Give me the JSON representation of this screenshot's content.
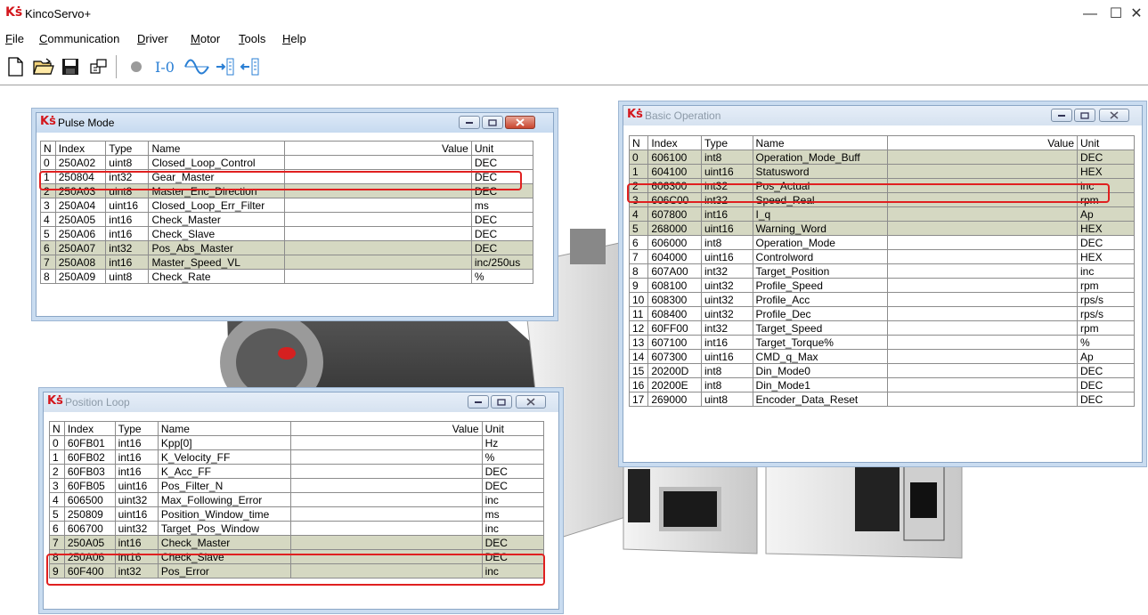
{
  "app": {
    "logo": "Kṡ",
    "title": "KincoServo+"
  },
  "window_controls": [
    "—",
    "☐",
    "✕"
  ],
  "menu": [
    "File",
    "Communication",
    "Driver",
    "Motor",
    "Tools",
    "Help"
  ],
  "menu_mnemonics": [
    "F",
    "C",
    "D",
    "M",
    "T",
    "H"
  ],
  "toolbar": {
    "items": [
      "new-file-icon",
      "open-folder-icon",
      "save-icon",
      "connect-icon",
      "record-icon",
      "io-icon",
      "scope-icon",
      "import-icon",
      "export-icon"
    ],
    "io_label": "I-0"
  },
  "columns": {
    "n": "N",
    "index": "Index",
    "type": "Type",
    "name": "Name",
    "value": "Value",
    "unit": "Unit"
  },
  "pulse_mode": {
    "logo": "Kṡ",
    "title": "Pulse Mode",
    "rows": [
      {
        "n": "0",
        "index": "250A02",
        "type": "uint8",
        "name": "Closed_Loop_Control",
        "value": "",
        "unit": "DEC",
        "hl": false
      },
      {
        "n": "1",
        "index": "250804",
        "type": "int32",
        "name": "Gear_Master",
        "value": "",
        "unit": "DEC",
        "hl": false
      },
      {
        "n": "2",
        "index": "250A03",
        "type": "uint8",
        "name": "Master_Enc_Direction",
        "value": "",
        "unit": "DEC",
        "hl": true
      },
      {
        "n": "3",
        "index": "250A04",
        "type": "uint16",
        "name": "Closed_Loop_Err_Filter",
        "value": "",
        "unit": "ms",
        "hl": false
      },
      {
        "n": "4",
        "index": "250A05",
        "type": "int16",
        "name": "Check_Master",
        "value": "",
        "unit": "DEC",
        "hl": false
      },
      {
        "n": "5",
        "index": "250A06",
        "type": "int16",
        "name": "Check_Slave",
        "value": "",
        "unit": "DEC",
        "hl": false
      },
      {
        "n": "6",
        "index": "250A07",
        "type": "int32",
        "name": "Pos_Abs_Master",
        "value": "",
        "unit": "DEC",
        "hl": true
      },
      {
        "n": "7",
        "index": "250A08",
        "type": "int16",
        "name": "Master_Speed_VL",
        "value": "",
        "unit": "inc/250us",
        "hl": true
      },
      {
        "n": "8",
        "index": "250A09",
        "type": "uint8",
        "name": "Check_Rate",
        "value": "",
        "unit": "%",
        "hl": false
      }
    ]
  },
  "position_loop": {
    "logo": "Kṡ",
    "title": "Position Loop",
    "rows": [
      {
        "n": "0",
        "index": "60FB01",
        "type": "int16",
        "name": "Kpp[0]",
        "value": "",
        "unit": "Hz",
        "hl": false
      },
      {
        "n": "1",
        "index": "60FB02",
        "type": "int16",
        "name": "K_Velocity_FF",
        "value": "",
        "unit": "%",
        "hl": false
      },
      {
        "n": "2",
        "index": "60FB03",
        "type": "int16",
        "name": "K_Acc_FF",
        "value": "",
        "unit": "DEC",
        "hl": false
      },
      {
        "n": "3",
        "index": "60FB05",
        "type": "uint16",
        "name": "Pos_Filter_N",
        "value": "",
        "unit": "DEC",
        "hl": false
      },
      {
        "n": "4",
        "index": "606500",
        "type": "uint32",
        "name": "Max_Following_Error",
        "value": "",
        "unit": "inc",
        "hl": false
      },
      {
        "n": "5",
        "index": "250809",
        "type": "uint16",
        "name": "Position_Window_time",
        "value": "",
        "unit": "ms",
        "hl": false
      },
      {
        "n": "6",
        "index": "606700",
        "type": "uint32",
        "name": "Target_Pos_Window",
        "value": "",
        "unit": "inc",
        "hl": false
      },
      {
        "n": "7",
        "index": "250A05",
        "type": "int16",
        "name": "Check_Master",
        "value": "",
        "unit": "DEC",
        "hl": true
      },
      {
        "n": "8",
        "index": "250A06",
        "type": "int16",
        "name": "Check_Slave",
        "value": "",
        "unit": "DEC",
        "hl": true
      },
      {
        "n": "9",
        "index": "60F400",
        "type": "int32",
        "name": "Pos_Error",
        "value": "",
        "unit": "inc",
        "hl": true
      }
    ]
  },
  "basic_operation": {
    "logo": "Kṡ",
    "title": "Basic Operation",
    "rows": [
      {
        "n": "0",
        "index": "606100",
        "type": "int8",
        "name": "Operation_Mode_Buff",
        "value": "",
        "unit": "DEC",
        "hl": true
      },
      {
        "n": "1",
        "index": "604100",
        "type": "uint16",
        "name": "Statusword",
        "value": "",
        "unit": "HEX",
        "hl": true
      },
      {
        "n": "2",
        "index": "606300",
        "type": "int32",
        "name": "Pos_Actual",
        "value": "",
        "unit": "inc",
        "hl": true
      },
      {
        "n": "3",
        "index": "606C00",
        "type": "int32",
        "name": "Speed_Real",
        "value": "",
        "unit": "rpm",
        "hl": true
      },
      {
        "n": "4",
        "index": "607800",
        "type": "int16",
        "name": "I_q",
        "value": "",
        "unit": "Ap",
        "hl": true
      },
      {
        "n": "5",
        "index": "268000",
        "type": "uint16",
        "name": "Warning_Word",
        "value": "",
        "unit": "HEX",
        "hl": true
      },
      {
        "n": "6",
        "index": "606000",
        "type": "int8",
        "name": "Operation_Mode",
        "value": "",
        "unit": "DEC",
        "hl": false
      },
      {
        "n": "7",
        "index": "604000",
        "type": "uint16",
        "name": "Controlword",
        "value": "",
        "unit": "HEX",
        "hl": false
      },
      {
        "n": "8",
        "index": "607A00",
        "type": "int32",
        "name": "Target_Position",
        "value": "",
        "unit": "inc",
        "hl": false
      },
      {
        "n": "9",
        "index": "608100",
        "type": "uint32",
        "name": "Profile_Speed",
        "value": "",
        "unit": "rpm",
        "hl": false
      },
      {
        "n": "10",
        "index": "608300",
        "type": "uint32",
        "name": "Profile_Acc",
        "value": "",
        "unit": "rps/s",
        "hl": false
      },
      {
        "n": "11",
        "index": "608400",
        "type": "uint32",
        "name": "Profile_Dec",
        "value": "",
        "unit": "rps/s",
        "hl": false
      },
      {
        "n": "12",
        "index": "60FF00",
        "type": "int32",
        "name": "Target_Speed",
        "value": "",
        "unit": "rpm",
        "hl": false
      },
      {
        "n": "13",
        "index": "607100",
        "type": "int16",
        "name": "Target_Torque%",
        "value": "",
        "unit": "%",
        "hl": false
      },
      {
        "n": "14",
        "index": "607300",
        "type": "uint16",
        "name": "CMD_q_Max",
        "value": "",
        "unit": "Ap",
        "hl": false
      },
      {
        "n": "15",
        "index": "20200D",
        "type": "int8",
        "name": "Din_Mode0",
        "value": "",
        "unit": "DEC",
        "hl": false
      },
      {
        "n": "16",
        "index": "20200E",
        "type": "int8",
        "name": "Din_Mode1",
        "value": "",
        "unit": "DEC",
        "hl": false
      },
      {
        "n": "17",
        "index": "269000",
        "type": "uint8",
        "name": "Encoder_Data_Reset",
        "value": "",
        "unit": "DEC",
        "hl": false
      }
    ]
  },
  "colors": {
    "brand_red": "#d3171d",
    "row_highlight": "#d5d8c2",
    "annotation_red": "#e02020"
  }
}
